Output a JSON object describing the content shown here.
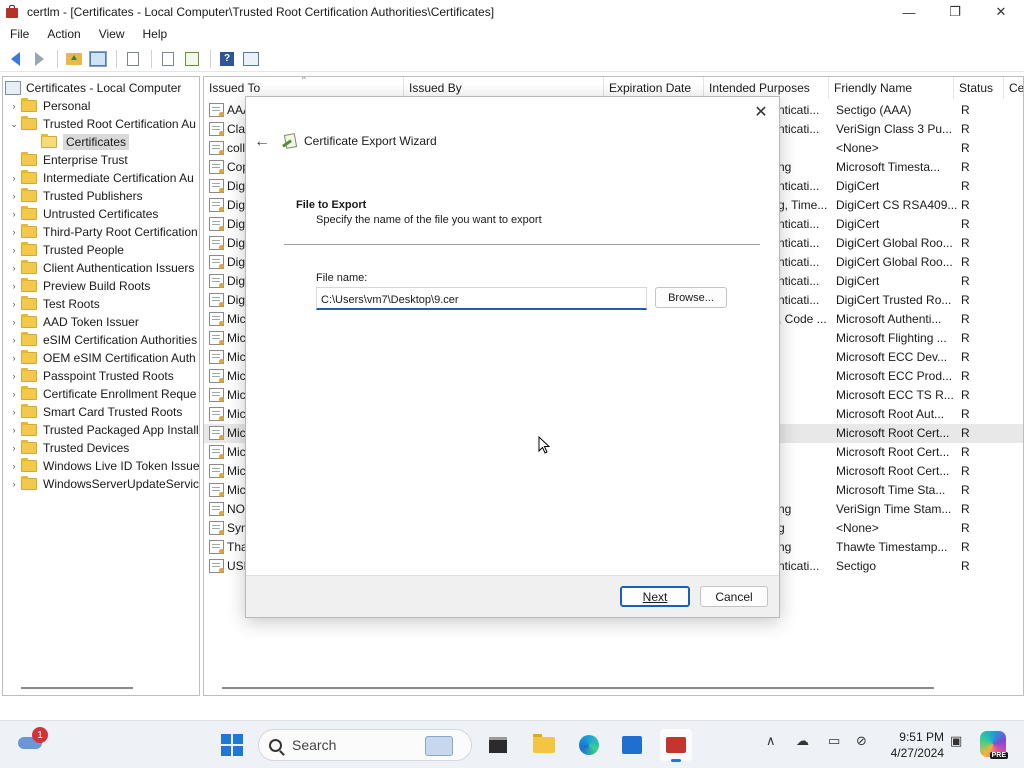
{
  "window": {
    "title": "certlm - [Certificates - Local Computer\\Trusted Root Certification Authorities\\Certificates]",
    "minimize_glyph": "—",
    "maximize_glyph": "❐",
    "close_glyph": "✕"
  },
  "menu": [
    "File",
    "Action",
    "View",
    "Help"
  ],
  "toolbar": {
    "icons": [
      "back-icon",
      "forward-icon",
      "up-folder-icon",
      "show-hide-tree-icon",
      "copy-icon",
      "properties-icon",
      "export-list-icon",
      "help-icon",
      "action-pane-icon"
    ],
    "help_glyph": "?"
  },
  "tree": [
    {
      "label": "Certificates - Local Computer",
      "expander": "",
      "level": 0,
      "root": true
    },
    {
      "label": "Personal",
      "expander": "›",
      "level": 1
    },
    {
      "label": "Trusted Root Certification Au",
      "expander": "⌄",
      "level": 1
    },
    {
      "label": "Certificates",
      "expander": "",
      "level": 2,
      "selected": true
    },
    {
      "label": "Enterprise Trust",
      "expander": "",
      "level": 1
    },
    {
      "label": "Intermediate Certification Au",
      "expander": "›",
      "level": 1
    },
    {
      "label": "Trusted Publishers",
      "expander": "›",
      "level": 1
    },
    {
      "label": "Untrusted Certificates",
      "expander": "›",
      "level": 1
    },
    {
      "label": "Third-Party Root Certification",
      "expander": "›",
      "level": 1
    },
    {
      "label": "Trusted People",
      "expander": "›",
      "level": 1
    },
    {
      "label": "Client Authentication Issuers",
      "expander": "›",
      "level": 1
    },
    {
      "label": "Preview Build Roots",
      "expander": "›",
      "level": 1
    },
    {
      "label": "Test Roots",
      "expander": "›",
      "level": 1
    },
    {
      "label": "AAD Token Issuer",
      "expander": "›",
      "level": 1
    },
    {
      "label": "eSIM Certification Authorities",
      "expander": "›",
      "level": 1
    },
    {
      "label": "OEM eSIM Certification Auth",
      "expander": "›",
      "level": 1
    },
    {
      "label": "Passpoint Trusted Roots",
      "expander": "›",
      "level": 1
    },
    {
      "label": "Certificate Enrollment Reque",
      "expander": "›",
      "level": 1
    },
    {
      "label": "Smart Card Trusted Roots",
      "expander": "›",
      "level": 1
    },
    {
      "label": "Trusted Packaged App Install",
      "expander": "›",
      "level": 1
    },
    {
      "label": "Trusted Devices",
      "expander": "›",
      "level": 1
    },
    {
      "label": "Windows Live ID Token Issuer",
      "expander": "›",
      "level": 1
    },
    {
      "label": "WindowsServerUpdateService",
      "expander": "›",
      "level": 1
    }
  ],
  "list": {
    "columns": [
      "Issued To",
      "Issued By",
      "Expiration Date",
      "Intended Purposes",
      "Friendly Name",
      "Status",
      "Ce"
    ],
    "rows": [
      {
        "issued_to": "AAA",
        "purposes": "nticati...",
        "friendly": "Sectigo (AAA)",
        "status": "R"
      },
      {
        "issued_to": "Clas",
        "purposes": "nticati...",
        "friendly": "VeriSign Class 3 Pu...",
        "status": "R"
      },
      {
        "issued_to": "coll",
        "purposes": "",
        "friendly": "<None>",
        "status": "R"
      },
      {
        "issued_to": "Cop",
        "purposes": "ng",
        "friendly": "Microsoft Timesta...",
        "status": "R"
      },
      {
        "issued_to": "Digi",
        "purposes": "nticati...",
        "friendly": "DigiCert",
        "status": "R"
      },
      {
        "issued_to": "Digi",
        "purposes": "g, Time...",
        "friendly": "DigiCert CS RSA409...",
        "status": "R"
      },
      {
        "issued_to": "Digi",
        "purposes": "nticati...",
        "friendly": "DigiCert",
        "status": "R"
      },
      {
        "issued_to": "Digi",
        "purposes": "nticati...",
        "friendly": "DigiCert Global Roo...",
        "status": "R"
      },
      {
        "issued_to": "Digi",
        "purposes": "nticati...",
        "friendly": "DigiCert Global Roo...",
        "status": "R"
      },
      {
        "issued_to": "Digi",
        "purposes": "nticati...",
        "friendly": "DigiCert",
        "status": "R"
      },
      {
        "issued_to": "Digi",
        "purposes": "nticati...",
        "friendly": "DigiCert Trusted Ro...",
        "status": "R"
      },
      {
        "issued_to": "Mic",
        "purposes": ", Code ...",
        "friendly": "Microsoft Authenti...",
        "status": "R"
      },
      {
        "issued_to": "Mic",
        "purposes": "",
        "friendly": "Microsoft Flighting ...",
        "status": "R"
      },
      {
        "issued_to": "Mic",
        "purposes": "",
        "friendly": "Microsoft ECC Dev...",
        "status": "R"
      },
      {
        "issued_to": "Mic",
        "purposes": "",
        "friendly": "Microsoft ECC Prod...",
        "status": "R"
      },
      {
        "issued_to": "Mic",
        "purposes": "",
        "friendly": "Microsoft ECC TS R...",
        "status": "R"
      },
      {
        "issued_to": "Mic",
        "purposes": "",
        "friendly": "Microsoft Root Aut...",
        "status": "R"
      },
      {
        "issued_to": "Mic",
        "purposes": "",
        "friendly": "Microsoft Root Cert...",
        "status": "R",
        "highlight": true
      },
      {
        "issued_to": "Mic",
        "purposes": "",
        "friendly": "Microsoft Root Cert...",
        "status": "R"
      },
      {
        "issued_to": "Mic",
        "purposes": "",
        "friendly": "Microsoft Root Cert...",
        "status": "R"
      },
      {
        "issued_to": "Mic",
        "purposes": "",
        "friendly": "Microsoft Time Sta...",
        "status": "R"
      },
      {
        "issued_to": "NO",
        "purposes": "ng",
        "friendly": "VeriSign Time Stam...",
        "status": "R"
      },
      {
        "issued_to": "Sym",
        "purposes": "g",
        "friendly": "<None>",
        "status": "R"
      },
      {
        "issued_to": "Tha",
        "purposes": "ng",
        "friendly": "Thawte Timestamp...",
        "status": "R"
      },
      {
        "issued_to": "USE",
        "purposes": "nticati...",
        "friendly": "Sectigo",
        "status": "R"
      }
    ]
  },
  "dialog": {
    "title": "Certificate Export Wizard",
    "back_glyph": "←",
    "close_glyph": "✕",
    "section_heading": "File to Export",
    "section_subtitle": "Specify the name of the file you want to export",
    "file_label": "File name:",
    "file_value": "C:\\Users\\vm7\\Desktop\\9.cer",
    "browse_label": "Browse...",
    "next_label": "Next",
    "cancel_label": "Cancel"
  },
  "taskbar": {
    "weather_badge": "1",
    "search_placeholder": "Search",
    "apps": [
      "terminal-app",
      "file-explorer-app",
      "edge-app",
      "store-app",
      "certlm-app"
    ],
    "tray_chevron": "∧",
    "time": "9:51 PM",
    "date": "4/27/2024",
    "copilot_badge": "PRE"
  },
  "colors": {
    "accent": "#1a5fb4",
    "list_highlight": "#e8e8e8",
    "taskbar_bg": "#eef1f5"
  }
}
